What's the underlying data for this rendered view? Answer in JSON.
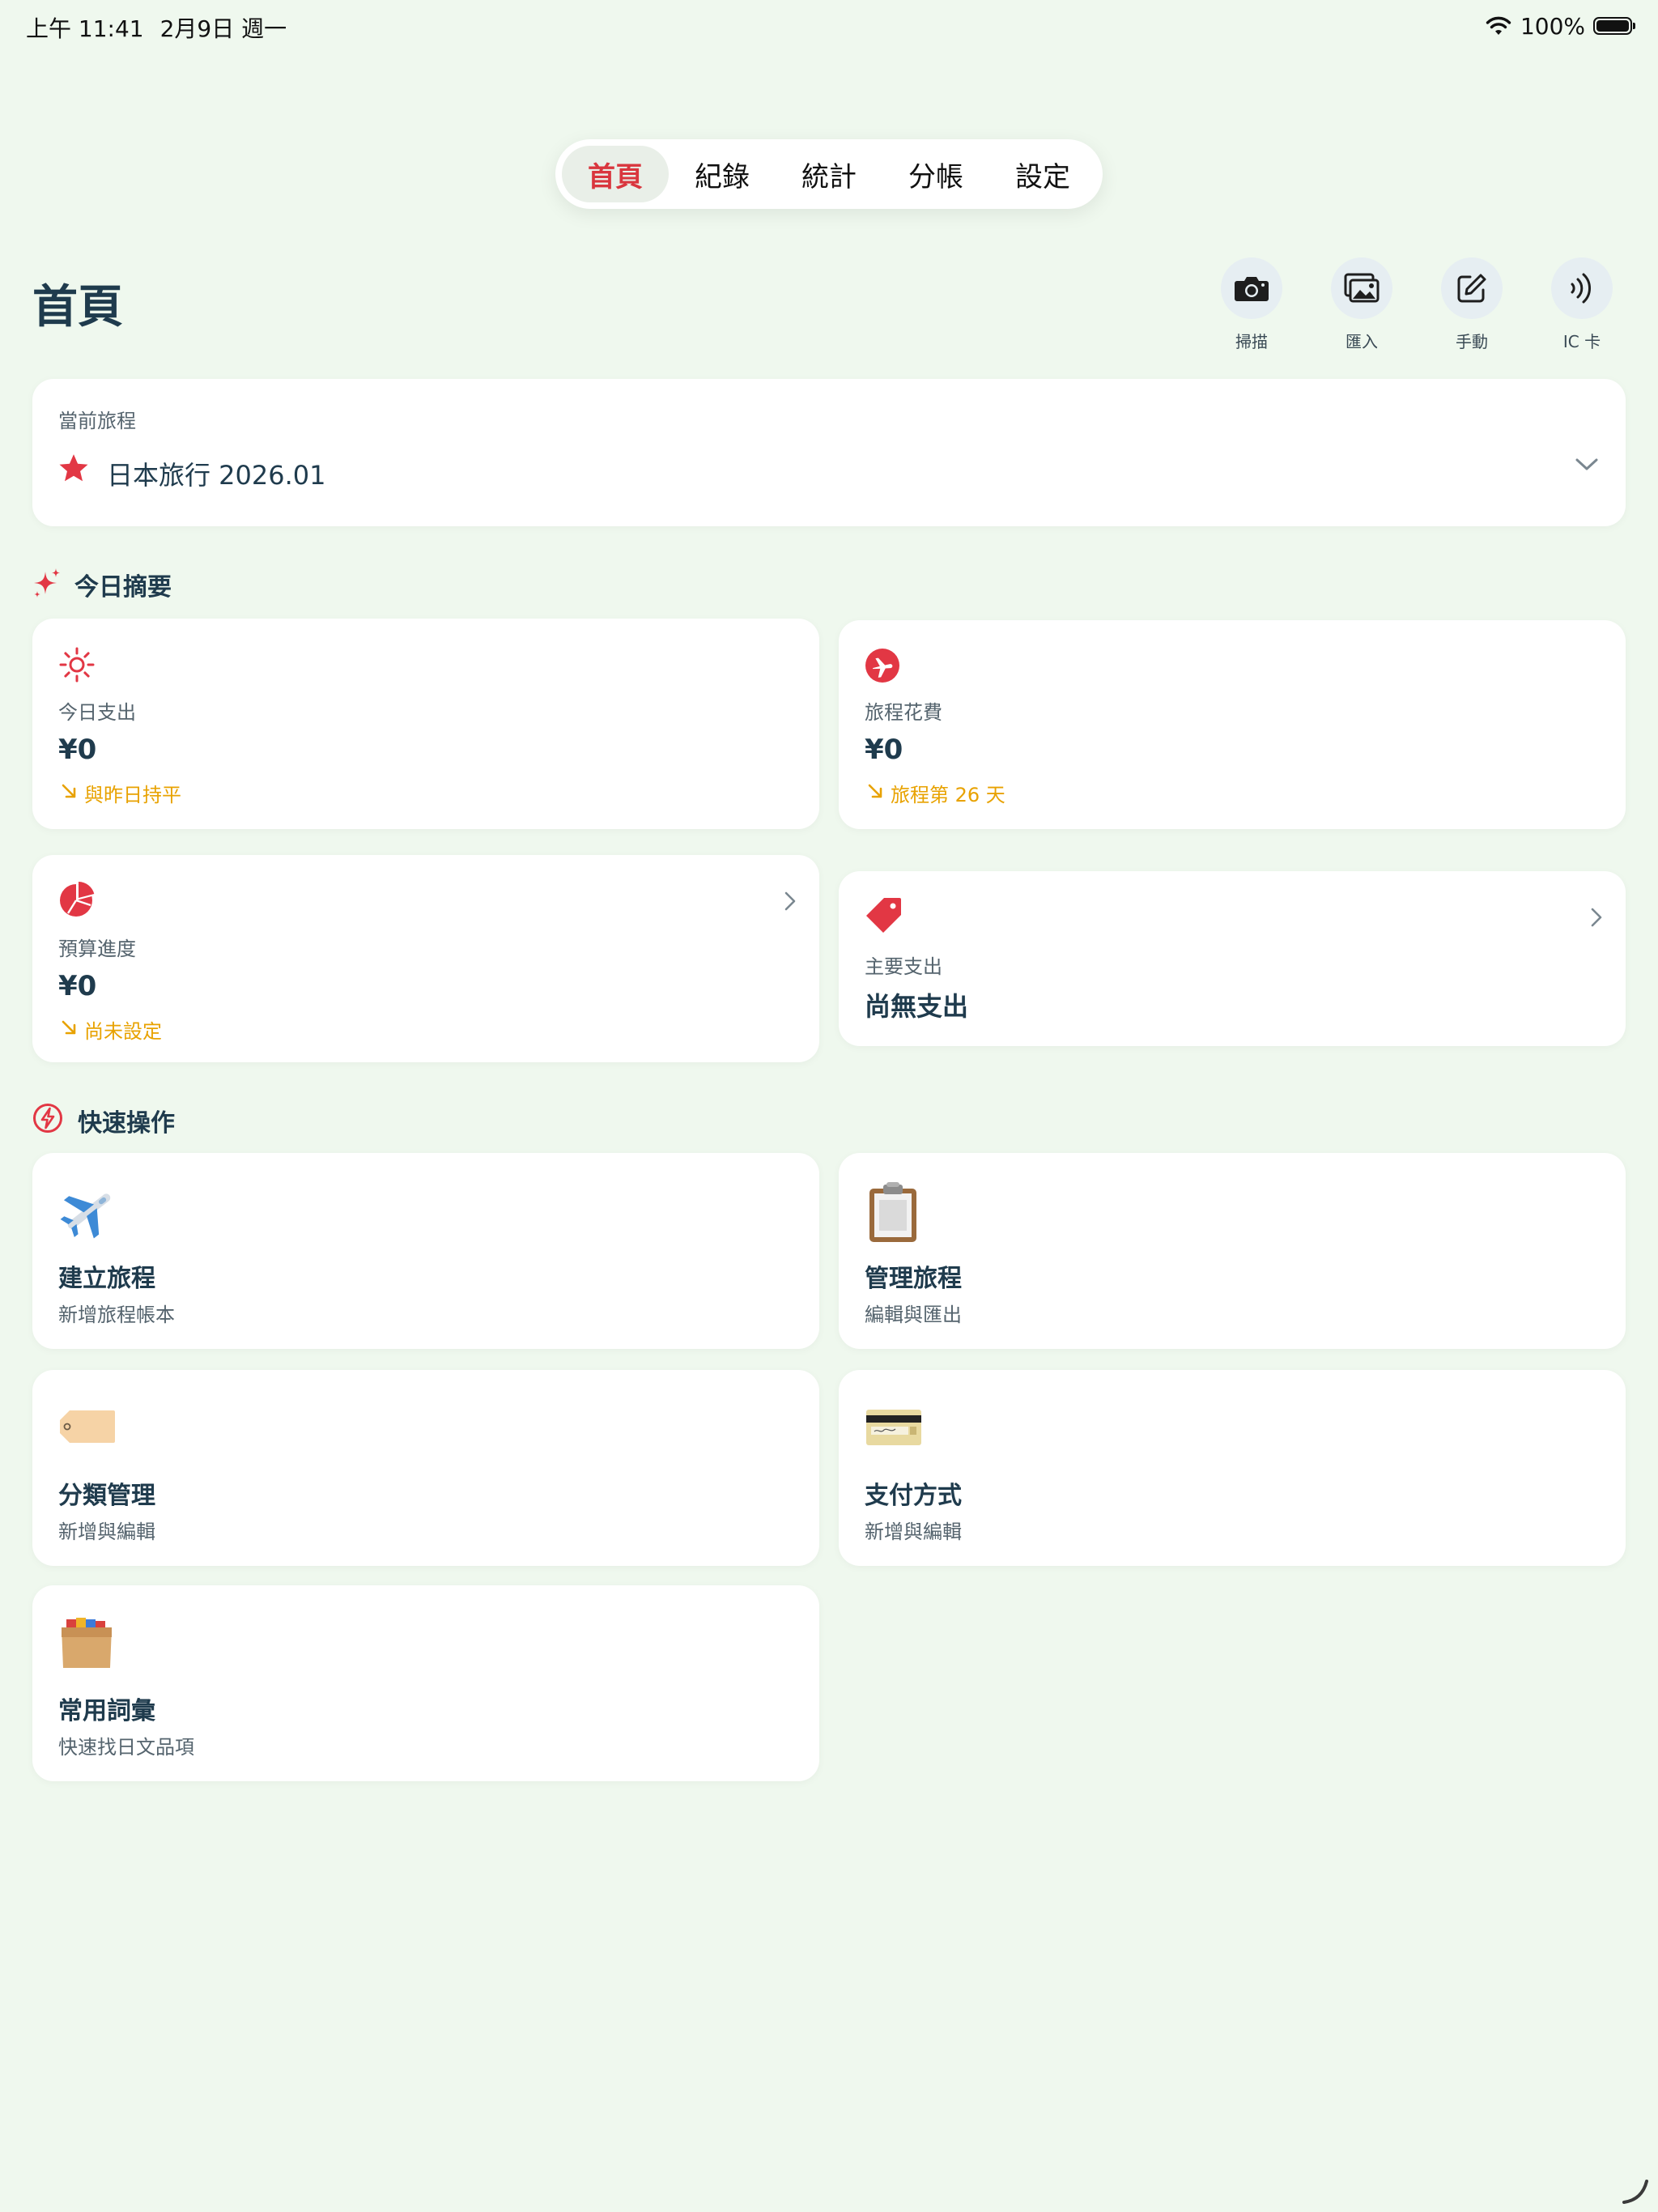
{
  "status_bar": {
    "time": "上午 11:41",
    "date": "2月9日 週一",
    "battery": "100%",
    "battery_level": 1.0
  },
  "tabs": [
    {
      "label": "首頁",
      "active": true
    },
    {
      "label": "紀錄",
      "active": false
    },
    {
      "label": "統計",
      "active": false
    },
    {
      "label": "分帳",
      "active": false
    },
    {
      "label": "設定",
      "active": false
    }
  ],
  "page_title": "首頁",
  "header_actions": [
    {
      "icon": "camera-icon",
      "label": "掃描"
    },
    {
      "icon": "photos-icon",
      "label": "匯入"
    },
    {
      "icon": "edit-icon",
      "label": "手動"
    },
    {
      "icon": "nfc-icon",
      "label": "IC 卡"
    }
  ],
  "current_trip": {
    "label": "當前旅程",
    "name": "日本旅行 2026.01",
    "icon": "star-icon"
  },
  "today_summary": {
    "title": "今日摘要",
    "cards": [
      {
        "icon": "sun-icon",
        "label": "今日支出",
        "value": "¥0",
        "note": "與昨日持平"
      },
      {
        "icon": "airplane-circle-icon",
        "label": "旅程花費",
        "value": "¥0",
        "note": "旅程第 26 天"
      },
      {
        "icon": "pie-chart-icon",
        "label": "預算進度",
        "value": "¥0",
        "note": "尚未設定"
      },
      {
        "icon": "tag-icon",
        "label": "主要支出",
        "value": "尚無支出"
      }
    ]
  },
  "quick_actions": {
    "title": "快速操作",
    "items": [
      {
        "icon": "airplane-emoji-icon",
        "title": "建立旅程",
        "subtitle": "新增旅程帳本"
      },
      {
        "icon": "clipboard-emoji-icon",
        "title": "管理旅程",
        "subtitle": "編輯與匯出"
      },
      {
        "icon": "label-tag-emoji-icon",
        "title": "分類管理",
        "subtitle": "新增與編輯"
      },
      {
        "icon": "credit-card-emoji-icon",
        "title": "支付方式",
        "subtitle": "新增與編輯"
      },
      {
        "icon": "card-box-emoji-icon",
        "title": "常用詞彙",
        "subtitle": "快速找日文品項"
      }
    ]
  },
  "colors": {
    "background": "#EFF8EE",
    "accent_red": "#E23744",
    "note_amber": "#E8A200",
    "text_dark": "#1F3B4D"
  }
}
